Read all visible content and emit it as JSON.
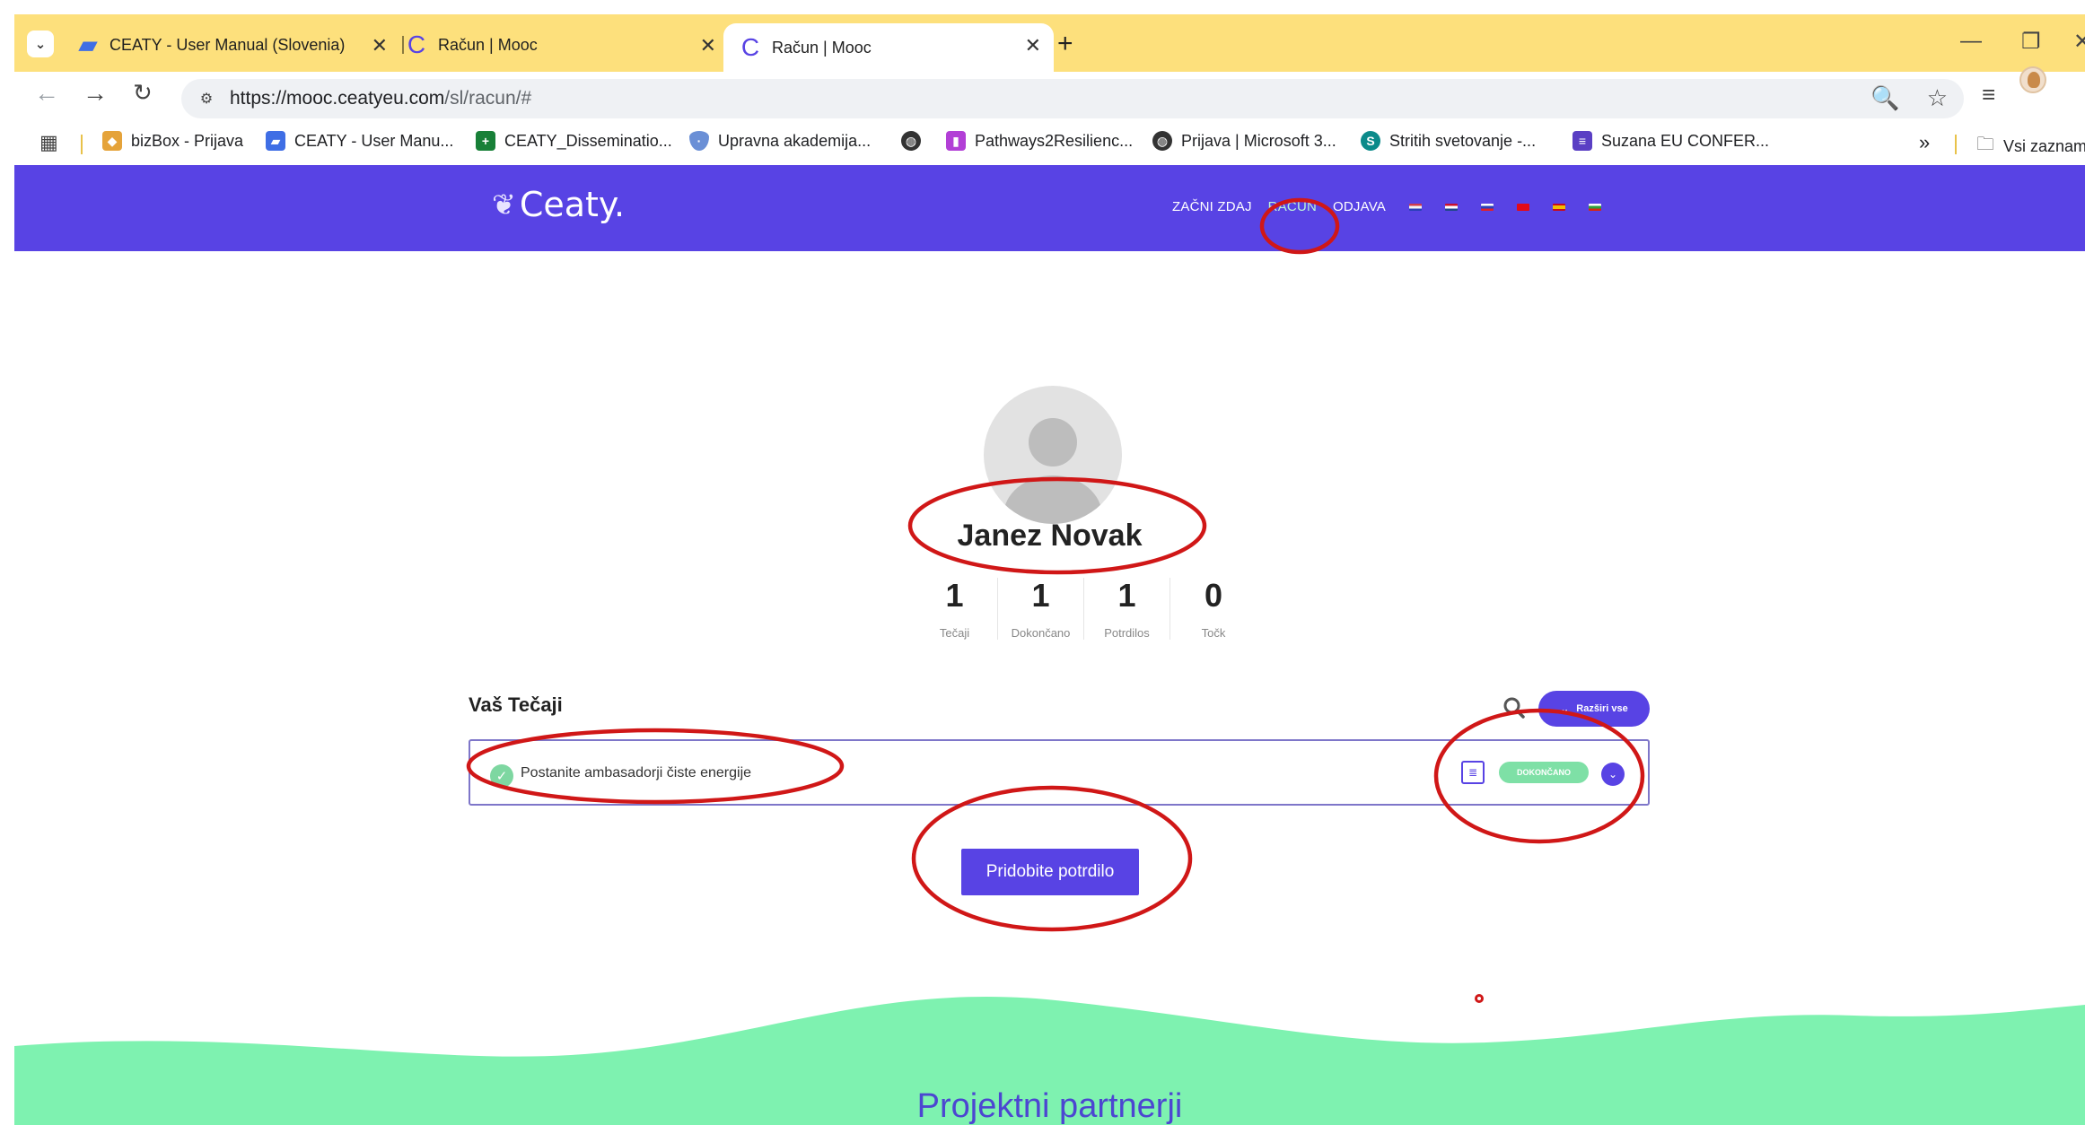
{
  "browser": {
    "tabs": [
      {
        "title": "CEATY - User Manual (Slovenia)",
        "favicon": "document-icon",
        "color": "#3f6ee5"
      },
      {
        "title": "Račun | Mooc",
        "favicon": "ceaty-c-icon",
        "color": "#5843e4"
      },
      {
        "title": "Račun | Mooc",
        "favicon": "ceaty-c-icon",
        "color": "#5843e4",
        "active": true
      }
    ],
    "url_host": "https://mooc.ceatyeu.com",
    "url_path": "/sl/racun/#",
    "bookmarks": [
      {
        "label": "bizBox - Prijava",
        "icon": "cube-icon",
        "color": "#e5a33a"
      },
      {
        "label": "CEATY - User Manu...",
        "icon": "document-icon",
        "color": "#3f6ee5"
      },
      {
        "label": "CEATY_Disseminatio...",
        "icon": "sheet-icon",
        "color": "#188038"
      },
      {
        "label": "Upravna akademija...",
        "icon": "shield-icon",
        "color": "#6a8fd6"
      },
      {
        "label": "",
        "icon": "globe-icon",
        "color": "#333333"
      },
      {
        "label": "Pathways2Resilienc...",
        "icon": "trello-icon",
        "color": "#b23fd6"
      },
      {
        "label": "Prijava | Microsoft 3...",
        "icon": "globe-icon",
        "color": "#333333"
      },
      {
        "label": "Stritih svetovanje -...",
        "icon": "sharepoint-icon",
        "color": "#0b8a8a"
      },
      {
        "label": "Suzana EU CONFER...",
        "icon": "form-icon",
        "color": "#5a3fc4"
      }
    ],
    "bookmarks_more": "»",
    "all_bookmarks": "Vsi zaznamki"
  },
  "site": {
    "logo": "Ceaty.",
    "nav": {
      "start": "ZAČNI ZDAJ",
      "account": "RAČUN",
      "logout": "ODJAVA"
    },
    "flags": [
      "#cf3b4b",
      "#c8102e",
      "#2a3fb8",
      "#e30a17",
      "#f1bf00",
      "#2e9e3c"
    ]
  },
  "profile": {
    "name": "Janez Novak",
    "stats": [
      {
        "value": "1",
        "label": "Tečaji"
      },
      {
        "value": "1",
        "label": "Dokončano"
      },
      {
        "value": "1",
        "label": "Potrdilos"
      },
      {
        "value": "0",
        "label": "Točk"
      }
    ]
  },
  "courses": {
    "title": "Vaš Tečaji",
    "expand_all": "Razširi vse",
    "items": [
      {
        "name": "Postanite ambasadorji čiste energije",
        "status": "DOKONČANO"
      }
    ],
    "certificate_button": "Pridobite potrdilo"
  },
  "footer": {
    "partners_title": "Projektni partnerji",
    "color": "#7ef2b0"
  },
  "colors": {
    "accent": "#5843e4",
    "annotation": "#d01717",
    "tabstrip": "#fde07c"
  }
}
